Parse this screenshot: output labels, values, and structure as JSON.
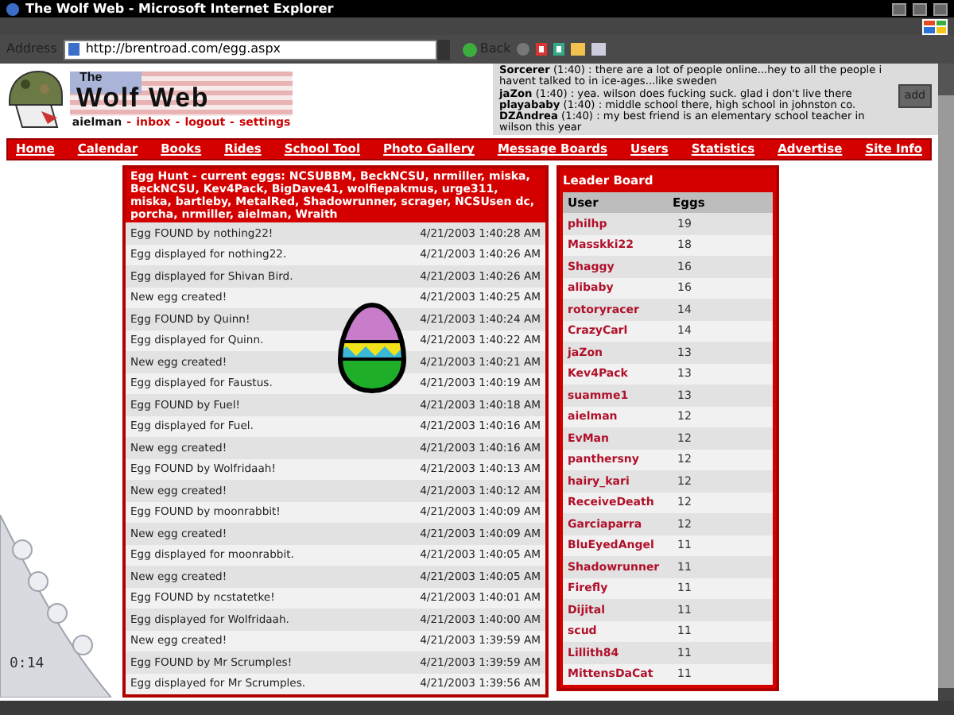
{
  "window": {
    "title": "The Wolf Web - Microsoft Internet Explorer"
  },
  "address_bar": {
    "label": "Address",
    "url": "http://brentroad.com/egg.aspx",
    "back_label": "Back"
  },
  "logo": {
    "line_1": "The",
    "line_2": "Wolf Web"
  },
  "user_links": [
    {
      "kind": "user",
      "label": "aielman"
    },
    {
      "kind": "sep",
      "label": "-"
    },
    {
      "kind": "link",
      "label": "inbox"
    },
    {
      "kind": "sep",
      "label": "-"
    },
    {
      "kind": "link",
      "label": "logout"
    },
    {
      "kind": "sep",
      "label": "-"
    },
    {
      "kind": "link",
      "label": "settings"
    }
  ],
  "chat": {
    "messages": [
      "**Sorcerer** (1:40) : there are a lot of people online...hey to all the people i havent talked to in ice-ages...like sweden",
      "**jaZon** (1:40) : yea. wilson does fucking suck. glad i don't live there",
      "**playababy** (1:40) : middle school there, high school in johnston co.",
      "**DZAndrea** (1:40) : my best friend is an elementary school teacher in wilson this year"
    ],
    "add_button": "add"
  },
  "nav": [
    "Home",
    "Calendar",
    "Books",
    "Rides",
    "School Tool",
    "Photo Gallery",
    "Message Boards",
    "Users",
    "Statistics",
    "Advertise",
    "Site Info"
  ],
  "egg_hunt": {
    "header": "Egg Hunt - current eggs: NCSUBBM, BeckNCSU, nrmiller, miska, BeckNCSU, Kev4Pack, BigDave41, wolfiepakmus, urge311, miska, bartleby, MetalRed, Shadowrunner, scrager, NCSUsen dc, porcha, nrmiller, aielman, Wraith",
    "rows": [
      {
        "event": "Egg FOUND by nothing22!",
        "time": "4/21/2003 1:40:28 AM"
      },
      {
        "event": "Egg displayed for nothing22.",
        "time": "4/21/2003 1:40:26 AM"
      },
      {
        "event": "Egg displayed for Shivan Bird.",
        "time": "4/21/2003 1:40:26 AM"
      },
      {
        "event": "New egg created!",
        "time": "4/21/2003 1:40:25 AM"
      },
      {
        "event": "Egg FOUND by Quinn!",
        "time": "4/21/2003 1:40:24 AM"
      },
      {
        "event": "Egg displayed for Quinn.",
        "time": "4/21/2003 1:40:22 AM"
      },
      {
        "event": "New egg created!",
        "time": "4/21/2003 1:40:21 AM"
      },
      {
        "event": "Egg displayed for Faustus.",
        "time": "4/21/2003 1:40:19 AM"
      },
      {
        "event": "Egg FOUND by Fuel!",
        "time": "4/21/2003 1:40:18 AM"
      },
      {
        "event": "Egg displayed for Fuel.",
        "time": "4/21/2003 1:40:16 AM"
      },
      {
        "event": "New egg created!",
        "time": "4/21/2003 1:40:16 AM"
      },
      {
        "event": "Egg FOUND by Wolfridaah!",
        "time": "4/21/2003 1:40:13 AM"
      },
      {
        "event": "New egg created!",
        "time": "4/21/2003 1:40:12 AM"
      },
      {
        "event": "Egg FOUND by moonrabbit!",
        "time": "4/21/2003 1:40:09 AM"
      },
      {
        "event": "New egg created!",
        "time": "4/21/2003 1:40:09 AM"
      },
      {
        "event": "Egg displayed for moonrabbit.",
        "time": "4/21/2003 1:40:05 AM"
      },
      {
        "event": "New egg created!",
        "time": "4/21/2003 1:40:05 AM"
      },
      {
        "event": "Egg FOUND by ncstatetke!",
        "time": "4/21/2003 1:40:01 AM"
      },
      {
        "event": "Egg displayed for Wolfridaah.",
        "time": "4/21/2003 1:40:00 AM"
      },
      {
        "event": "New egg created!",
        "time": "4/21/2003 1:39:59 AM"
      },
      {
        "event": "Egg FOUND by Mr Scrumples!",
        "time": "4/21/2003 1:39:59 AM"
      },
      {
        "event": "Egg displayed for Mr Scrumples.",
        "time": "4/21/2003 1:39:56 AM"
      }
    ]
  },
  "leader_board": {
    "title": "Leader Board",
    "columns": [
      "User",
      "Eggs"
    ],
    "rows": [
      {
        "user": "philhp",
        "eggs": "19"
      },
      {
        "user": "Masskki22",
        "eggs": "18"
      },
      {
        "user": "Shaggy",
        "eggs": "16"
      },
      {
        "user": "alibaby",
        "eggs": "16"
      },
      {
        "user": "rotoryracer",
        "eggs": "14"
      },
      {
        "user": "CrazyCarl",
        "eggs": "14"
      },
      {
        "user": "jaZon",
        "eggs": "13"
      },
      {
        "user": "Kev4Pack",
        "eggs": "13"
      },
      {
        "user": "suamme1",
        "eggs": "13"
      },
      {
        "user": "aielman",
        "eggs": "12"
      },
      {
        "user": "EvMan",
        "eggs": "12"
      },
      {
        "user": "panthersny",
        "eggs": "12"
      },
      {
        "user": "hairy_kari",
        "eggs": "12"
      },
      {
        "user": "ReceiveDeath",
        "eggs": "12"
      },
      {
        "user": "Garciaparra",
        "eggs": "12"
      },
      {
        "user": "BluEyedAngel",
        "eggs": "11"
      },
      {
        "user": "Shadowrunner",
        "eggs": "11"
      },
      {
        "user": "Firefly",
        "eggs": "11"
      },
      {
        "user": "Dijital",
        "eggs": "11"
      },
      {
        "user": "scud",
        "eggs": "11"
      },
      {
        "user": "Lillith84",
        "eggs": "11"
      },
      {
        "user": "MittensDaCat",
        "eggs": "11"
      }
    ]
  },
  "media_player": {
    "time": "0:14"
  }
}
